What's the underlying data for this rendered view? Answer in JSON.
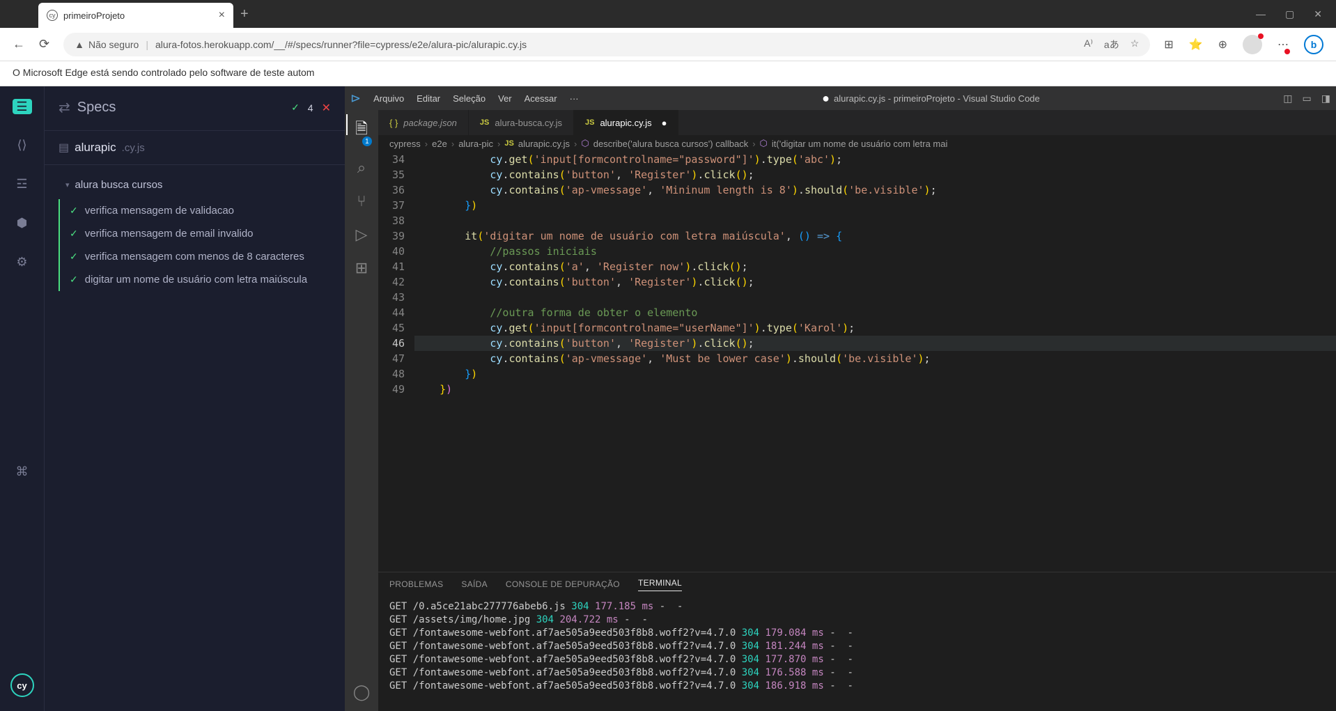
{
  "browser": {
    "tab_title": "primeiroProjeto",
    "insecure_label": "Não seguro",
    "url": "alura-fotos.herokuapp.com/__/#/specs/runner?file=cypress/e2e/alura-pic/alurapic.cy.js",
    "info_bar": "O Microsoft Edge está sendo controlado pelo software de teste autom"
  },
  "cypress": {
    "header_title": "Specs",
    "pass_count": "4",
    "spec_name": "alurapic",
    "spec_ext": ".cy.js",
    "suite_name": "alura busca cursos",
    "tests": [
      "verifica mensagem de validacao",
      "verifica mensagem de email invalido",
      "verifica mensagem com menos de 8 caracteres",
      "digitar um nome de usuário com letra maiúscula"
    ]
  },
  "vscode": {
    "menus": [
      "Arquivo",
      "Editar",
      "Seleção",
      "Ver",
      "Acessar",
      "···"
    ],
    "window_title": "alurapic.cy.js - primeiroProjeto - Visual Studio Code",
    "explorer_badge": "1",
    "tabs": [
      {
        "label": "package.json",
        "type": "json",
        "italic": true,
        "active": false,
        "modified": false
      },
      {
        "label": "alura-busca.cy.js",
        "type": "js",
        "italic": false,
        "active": false,
        "modified": false
      },
      {
        "label": "alurapic.cy.js",
        "type": "js",
        "italic": false,
        "active": true,
        "modified": true
      }
    ],
    "breadcrumb": [
      "cypress",
      "e2e",
      "alura-pic",
      "alurapic.cy.js",
      "describe('alura busca cursos') callback",
      "it('digitar um nome de usuário com letra mai"
    ],
    "line_numbers": [
      "34",
      "35",
      "36",
      "37",
      "38",
      "39",
      "40",
      "41",
      "42",
      "43",
      "44",
      "45",
      "46",
      "47",
      "48",
      "49"
    ],
    "current_line": "46",
    "panel_tabs": [
      "PROBLEMAS",
      "SAÍDA",
      "CONSOLE DE DEPURAÇÃO",
      "TERMINAL"
    ],
    "active_panel": "TERMINAL",
    "terminal": [
      {
        "method": "GET",
        "path": "/0.a5ce21abc277776abeb6.js",
        "status": "304",
        "time": "177.185 ms",
        "tail": "-  -"
      },
      {
        "method": "GET",
        "path": "/assets/img/home.jpg",
        "status": "304",
        "time": "204.722 ms",
        "tail": "-  -"
      },
      {
        "method": "GET",
        "path": "/fontawesome-webfont.af7ae505a9eed503f8b8.woff2?v=4.7.0",
        "status": "304",
        "time": "179.084 ms",
        "tail": "-  -"
      },
      {
        "method": "GET",
        "path": "/fontawesome-webfont.af7ae505a9eed503f8b8.woff2?v=4.7.0",
        "status": "304",
        "time": "181.244 ms",
        "tail": "-  -"
      },
      {
        "method": "GET",
        "path": "/fontawesome-webfont.af7ae505a9eed503f8b8.woff2?v=4.7.0",
        "status": "304",
        "time": "177.870 ms",
        "tail": "-  -"
      },
      {
        "method": "GET",
        "path": "/fontawesome-webfont.af7ae505a9eed503f8b8.woff2?v=4.7.0",
        "status": "304",
        "time": "176.588 ms",
        "tail": "-  -"
      },
      {
        "method": "GET",
        "path": "/fontawesome-webfont.af7ae505a9eed503f8b8.woff2?v=4.7.0",
        "status": "304",
        "time": "186.918 ms",
        "tail": "-  -"
      }
    ]
  }
}
